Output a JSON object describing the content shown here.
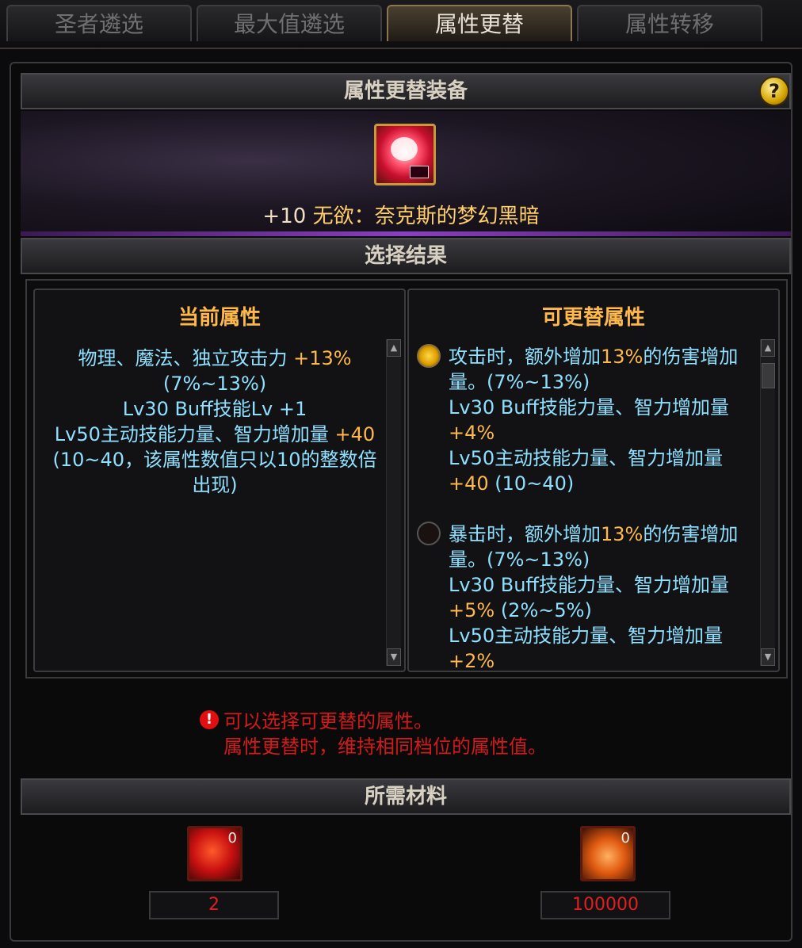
{
  "tabs": [
    {
      "label": "圣者遴选",
      "active": false
    },
    {
      "label": "最大值遴选",
      "active": false
    },
    {
      "label": "属性更替",
      "active": true
    },
    {
      "label": "属性转移",
      "active": false
    }
  ],
  "header": {
    "title": "属性更替装备",
    "help": "?"
  },
  "item": {
    "level": "+10",
    "name": "无欲：奈克斯的梦幻黑暗"
  },
  "section_result": "选择结果",
  "current": {
    "title": "当前属性",
    "line1_a": "物理、魔法、独立攻击力 ",
    "line1_hl": "+13%",
    "line1_b": " (7%~13%)",
    "line2": "Lv30 Buff技能Lv +1",
    "line3_a": "Lv50主动技能力量、智力增加量 ",
    "line3_hl": "+40",
    "line3_b": " (10~40，该属性数值只以10的整数倍出现)"
  },
  "replace": {
    "title": "可更替属性",
    "options": [
      {
        "selected": true,
        "a1": "攻击时，额外增加",
        "a1_hl": "13%",
        "a2": "的伤害增加量。(7%~13%)",
        "b1": "Lv30 Buff技能力量、智力增加量 ",
        "b1_hl": "+4%",
        "c1": "Lv50主动技能力量、智力增加量 ",
        "c1_hl": "+40",
        "c2": " (10~40)"
      },
      {
        "selected": false,
        "a1": "暴击时，额外增加",
        "a1_hl": "13%",
        "a2": "的伤害增加量。(7%~13%)",
        "b1": "Lv30 Buff技能力量、智力增加量 ",
        "b1_hl": "+5%",
        "b2": " (2%~5%)",
        "c1": "Lv50主动技能力量、智力增加量 ",
        "c1_hl": "+2%"
      }
    ]
  },
  "notice": {
    "line1": "可以选择可更替的属性。",
    "line2": "属性更替时，维持相同档位的属性值。"
  },
  "section_materials": "所需材料",
  "materials": [
    {
      "name": "material-1",
      "owned": "0",
      "required": "2"
    },
    {
      "name": "material-2",
      "owned": "0",
      "required": "100000"
    }
  ],
  "colors": {
    "highlight": "#ffb84a",
    "text": "#8fe0ff",
    "warning": "#d21a1a",
    "gold": "#ffcf6a"
  }
}
